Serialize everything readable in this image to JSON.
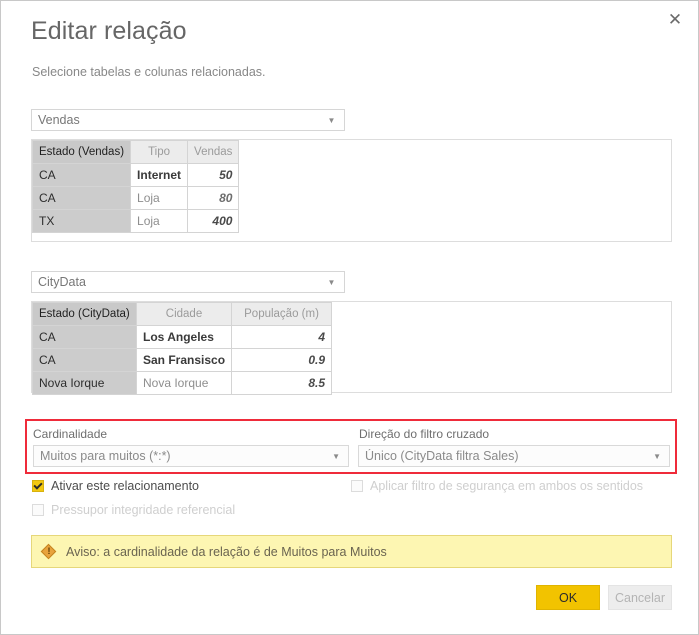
{
  "dialog": {
    "title": "Editar relação",
    "subtitle": "Selecione tabelas e colunas relacionadas.",
    "close_icon": "close-icon"
  },
  "sales_section": {
    "selected_table": "Vendas",
    "chevron_icon": "chevron-down-icon",
    "headers": [
      "Estado (Vendas)",
      "Tipo",
      "Vendas"
    ],
    "rows": [
      {
        "estado": "CA",
        "tipo": "Internet",
        "vendas": "50"
      },
      {
        "estado": "CA",
        "tipo": "Loja",
        "vendas": "80"
      },
      {
        "estado": "TX",
        "tipo": "Loja",
        "vendas": "400"
      }
    ]
  },
  "city_section": {
    "selected_table": "CityData",
    "chevron_icon": "chevron-down-icon",
    "headers": [
      "Estado (CityData)",
      "Cidade",
      "População (m)"
    ],
    "rows": [
      {
        "estado": "CA",
        "cidade": "Los Angeles",
        "populacao": "4"
      },
      {
        "estado": "CA",
        "cidade": "San Fransisco",
        "populacao": "0.9"
      },
      {
        "estado": "Nova Iorque",
        "cidade": "Nova Iorque",
        "populacao": "8.5"
      }
    ]
  },
  "options": {
    "cardinality_label": "Cardinalidade",
    "cardinality_value": "Muitos para muitos (*:*)",
    "cross_filter_label": "Direção do filtro cruzado",
    "cross_filter_value": "Único (CityData filtra Sales)",
    "highlight_color": "#ef2b3a",
    "chevron_icon": "chevron-down-icon"
  },
  "checkboxes": {
    "active_relationship": "Ativar este relacionamento",
    "bidirectional_security": "Aplicar filtro de segurança em ambos os sentidos",
    "assume_referential_integrity": "Pressupor integridade referencial"
  },
  "warning": {
    "icon": "warning-icon",
    "glyph": "!",
    "text": "Aviso: a cardinalidade da relação é de Muitos para Muitos",
    "background_color": "#fdf6b2"
  },
  "footer": {
    "ok_label": "OK",
    "cancel_label": "Cancelar",
    "ok_color": "#f2c300"
  }
}
